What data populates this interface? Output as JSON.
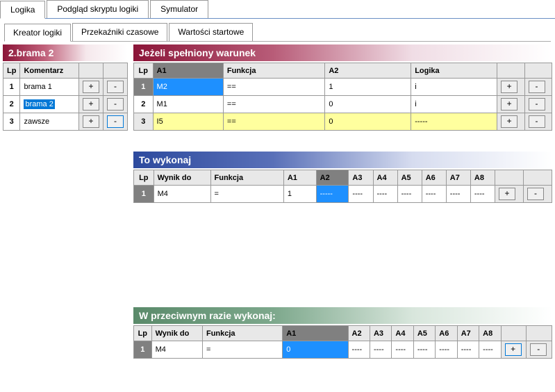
{
  "topTabs": {
    "t1": "Logika",
    "t2": "Podgląd skryptu logiki",
    "t3": "Symulator"
  },
  "subTabs": {
    "s1": "Kreator logiki",
    "s2": "Przekaźniki czasowe",
    "s3": "Wartości startowe"
  },
  "left": {
    "title": "2.brama 2",
    "cols": {
      "lp": "Lp",
      "kom": "Komentarz"
    },
    "r1": {
      "lp": "1",
      "kom": "brama 1"
    },
    "r2": {
      "lp": "2",
      "kom": "brama 2"
    },
    "r3": {
      "lp": "3",
      "kom": "zawsze"
    },
    "plus": "+",
    "minus": "-"
  },
  "cond": {
    "title": "Jeżeli spełniony warunek",
    "cols": {
      "lp": "Lp",
      "a1": "A1",
      "fn": "Funkcja",
      "a2": "A2",
      "log": "Logika"
    },
    "r1": {
      "lp": "1",
      "a1": "M2",
      "fn": "==",
      "a2": "1",
      "log": "i"
    },
    "r2": {
      "lp": "2",
      "a1": "M1",
      "fn": "==",
      "a2": "0",
      "log": "i"
    },
    "r3": {
      "lp": "3",
      "a1": "I5",
      "fn": "==",
      "a2": "0",
      "log": "-----"
    },
    "plus": "+",
    "minus": "-"
  },
  "then": {
    "title": "To wykonaj",
    "cols": {
      "lp": "Lp",
      "wyn": "Wynik do",
      "fn": "Funkcja",
      "a1": "A1",
      "a2": "A2",
      "a3": "A3",
      "a4": "A4",
      "a5": "A5",
      "a6": "A6",
      "a7": "A7",
      "a8": "A8"
    },
    "r1": {
      "lp": "1",
      "wyn": "M4",
      "fn": "=",
      "a1": "1",
      "a2": "-----",
      "a3": "----",
      "a4": "----",
      "a5": "----",
      "a6": "----",
      "a7": "----",
      "a8": "----"
    },
    "plus": "+",
    "minus": "-"
  },
  "else": {
    "title": "W przeciwnym razie wykonaj:",
    "cols": {
      "lp": "Lp",
      "wyn": "Wynik do",
      "fn": "Funkcja",
      "a1": "A1",
      "a2": "A2",
      "a3": "A3",
      "a4": "A4",
      "a5": "A5",
      "a6": "A6",
      "a7": "A7",
      "a8": "A8"
    },
    "r1": {
      "lp": "1",
      "wyn": "M4",
      "fn": "=",
      "a1": "0",
      "a2": "----",
      "a3": "----",
      "a4": "----",
      "a5": "----",
      "a6": "----",
      "a7": "----",
      "a8": "----"
    },
    "plus": "+",
    "minus": "-"
  }
}
